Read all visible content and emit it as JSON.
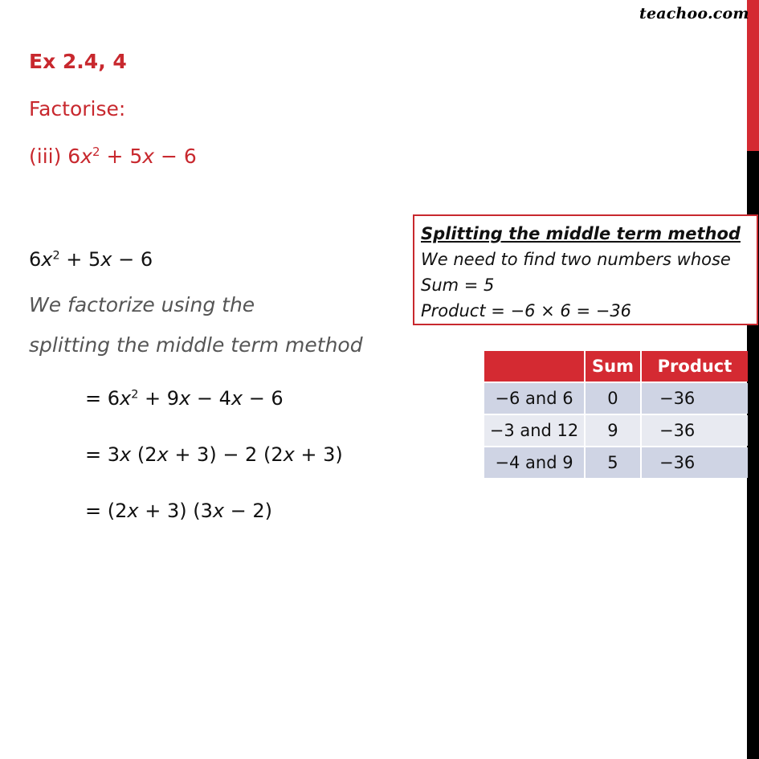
{
  "brand": {
    "logo_text": "teachoo.com"
  },
  "colors": {
    "accent_red": "#c8282e",
    "sidebar_red": "#d42a32",
    "sidebar_black": "#000000",
    "note_gray": "#555555",
    "row_dark": "#cfd4e4",
    "row_light": "#e8eaf1"
  },
  "question": {
    "title": "Ex 2.4, 4",
    "instruction": "Factorise:",
    "part_label": "(iii) ",
    "expr": {
      "a": "6",
      "var": "x",
      "exp": "2",
      "rest1": " + 5",
      "var2": "x",
      "rest2": " − 6"
    }
  },
  "solution": {
    "expr": {
      "a": "6",
      "var": "x",
      "exp": "2",
      "rest1": " + 5",
      "var2": "x",
      "rest2": " − 6"
    },
    "note_line1": "We factorize using the",
    "note_line2": "splitting the middle term method",
    "steps": [
      {
        "p1": "= 6",
        "v1": "x",
        "exp": "2",
        "p2": " + 9",
        "v2": "x",
        "p3": " − 4",
        "v3": "x",
        "p4": " − 6"
      },
      {
        "p1": "= 3",
        "v1": "x",
        "p2": " (2",
        "v2": "x",
        "p3": " + 3) − 2 (2",
        "v3": "x",
        "p4": " + 3)"
      },
      {
        "p1": "= (2",
        "v1": "x",
        "p2": " + 3) (3",
        "v2": "x",
        "p3": " − 2)"
      }
    ]
  },
  "method_box": {
    "heading": "Splitting the middle term method",
    "line1": "We need to find two numbers whose",
    "line2": "Sum = 5",
    "line3": "Product = −6 × 6 = −36"
  },
  "table": {
    "headers": [
      "",
      "Sum",
      "Product"
    ],
    "rows": [
      [
        "−6 and 6",
        "0",
        "−36"
      ],
      [
        "−3 and 12",
        "9",
        "−36"
      ],
      [
        "−4 and 9",
        "5",
        "−36"
      ]
    ]
  }
}
